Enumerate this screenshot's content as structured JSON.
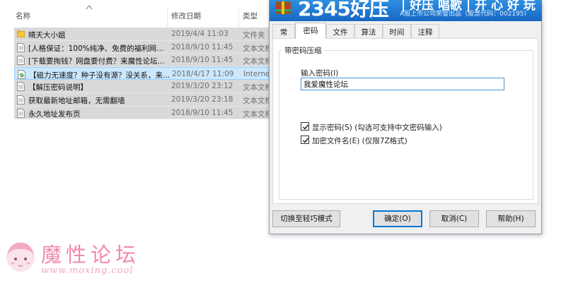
{
  "explorer": {
    "columns": {
      "name": "名称",
      "date": "修改日期",
      "type": "类型"
    },
    "files": [
      {
        "icon": "folder-icon",
        "name": "晴天大小姐",
        "date": "2019/4/4 11:03",
        "type": "文件夹"
      },
      {
        "icon": "text-file-icon",
        "name": "[人格保证：100%纯净、免费的福利网站...",
        "date": "2018/9/10 11:45",
        "type": "文本文档"
      },
      {
        "icon": "text-file-icon",
        "name": "[下载要掏钱？网盘要付费？来魔性论坛...",
        "date": "2018/9/10 11:45",
        "type": "文本文档"
      },
      {
        "icon": "internet-shortcut-icon",
        "name": "【磁力无速度？种子没有源？没关系，来...",
        "date": "2018/4/17 11:09",
        "type": "Internet"
      },
      {
        "icon": "text-file-icon",
        "name": "【解压密码说明】",
        "date": "2019/3/20 23:12",
        "type": "文本文档"
      },
      {
        "icon": "text-file-icon",
        "name": "获取最新地址邮箱，无需翻墙",
        "date": "2019/3/20 23:18",
        "type": "文本文档"
      },
      {
        "icon": "text-file-icon",
        "name": "永久地址发布页",
        "date": "2018/9/10 11:45",
        "type": "文本文档"
      }
    ],
    "selected_index": 3
  },
  "dialog": {
    "banner": {
      "brand": "2345好压",
      "slogan": "| 好压 唱歌 | 开 心 好 玩",
      "subline": "A股上市公司荣誉出品（股票代码：002195）"
    },
    "tabs": [
      {
        "label": "常规",
        "active": false
      },
      {
        "label": "密码",
        "active": true
      },
      {
        "label": "文件",
        "active": false
      },
      {
        "label": "算法",
        "active": false
      },
      {
        "label": "时间",
        "active": false
      },
      {
        "label": "注释",
        "active": false
      }
    ],
    "group_title": "带密码压缩",
    "password_label": "输入密码(I)",
    "password_value": "我爱魔性论坛",
    "options": [
      {
        "label": "显示密码(S)   (勾选可支持中文密码输入)",
        "checked": true
      },
      {
        "label": "加密文件名(E)   (仅限7Z格式)",
        "checked": true
      }
    ],
    "buttons": {
      "simple_mode": "切换至轻巧模式",
      "ok": "确定(O)",
      "cancel": "取消(C)",
      "help": "帮助(H)"
    }
  },
  "watermark": {
    "title": "魔性论坛",
    "url": "www.moxing.cool"
  },
  "colors": {
    "banner_blue": "#1f7fd8",
    "selection": "#cce8ff",
    "row_gray": "#d9d9d9",
    "watermark_pink": "#f28aa9"
  }
}
